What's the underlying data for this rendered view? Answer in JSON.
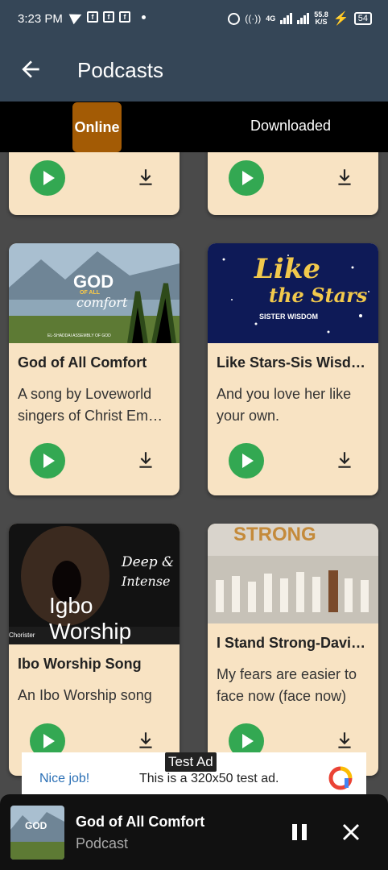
{
  "status_bar": {
    "time": "3:23 PM",
    "network_gen": "4G",
    "speed_value": "55.8",
    "speed_unit": "K/S",
    "battery": "54"
  },
  "app_bar": {
    "title": "Podcasts",
    "back_icon": "arrow-left-icon"
  },
  "tabs": [
    {
      "label": "Online",
      "selected": true
    },
    {
      "label": "Downloaded",
      "selected": false
    }
  ],
  "colors": {
    "app_bar": "#354657",
    "tab_selected": "#a35b05",
    "card_bg": "#f8e3c3",
    "play_button": "#33a852"
  },
  "cards": [
    {
      "title": "God of All Comfort",
      "description": "A song by Loveworld singers of Christ Em…",
      "art_text": [
        "GOD",
        "OF ALL",
        "comfort",
        "EL-SHADDAI ASSEMBLY OF GOD"
      ]
    },
    {
      "title": "Like Stars-Sis Wisd…",
      "description": "And you love her like your own.",
      "art_text": [
        "Like",
        "the Stars",
        "SISTER WISDOM"
      ]
    },
    {
      "title": "Ibo Worship Song",
      "description": "An Ibo Worship song",
      "art_text": [
        "Deep &",
        "Intense",
        "Igbo Worship",
        "Chorister"
      ]
    },
    {
      "title": "I Stand Strong-Davi…",
      "description": "My fears are easier to face now (face now)",
      "art_text": [
        "STRONG"
      ]
    }
  ],
  "ad": {
    "label": "Test Ad",
    "nice": "Nice job!",
    "text": "This is a 320x50 test ad."
  },
  "player": {
    "title": "God of All Comfort",
    "subtitle": "Podcast",
    "thumb_text": "GOD"
  }
}
